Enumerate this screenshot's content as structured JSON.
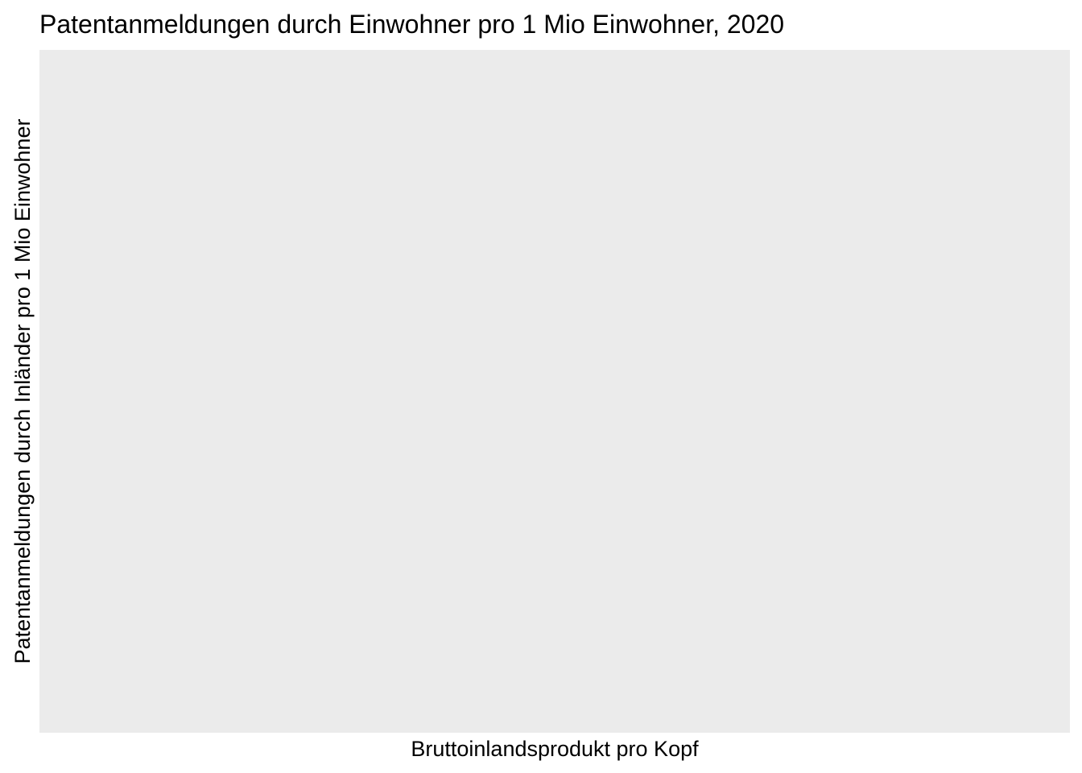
{
  "chart_data": {
    "type": "scatter",
    "title": "Patentanmeldungen durch Einwohner pro 1 Mio Einwohner, 2020",
    "xlabel": "Bruttoinlandsprodukt pro Kopf",
    "ylabel": "Patentanmeldungen durch Inländer pro 1 Mio Einwohner",
    "x": [],
    "y": [],
    "grid": false,
    "legend": "none",
    "colors": {
      "panel_background": "#ebebeb",
      "page_background": "#ffffff",
      "text": "#000000"
    }
  }
}
